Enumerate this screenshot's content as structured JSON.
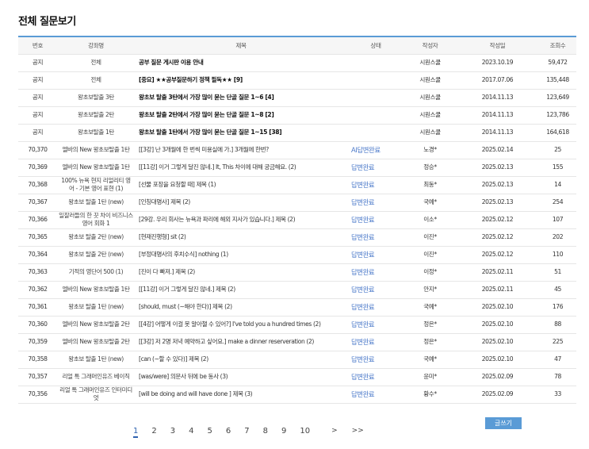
{
  "page_title": "전체 질문보기",
  "columns": [
    "번호",
    "강좌명",
    "제목",
    "상태",
    "작성자",
    "작성일",
    "조회수"
  ],
  "notices": [
    {
      "no": "공지",
      "course": "전체",
      "title": "공부 질문 게시판 이용 안내",
      "author": "시원스쿨",
      "date": "2023.10.19",
      "views": "59,472"
    },
    {
      "no": "공지",
      "course": "전체",
      "title": "[중요] ★★공부질문하기 정책 필독★★ [9]",
      "author": "시원스쿨",
      "date": "2017.07.06",
      "views": "135,448"
    },
    {
      "no": "공지",
      "course": "왕초보탈출 3탄",
      "title": "왕초보 탈출 3탄에서 가장 많이 묻는 단골 질문 1~6 [4]",
      "author": "시원스쿨",
      "date": "2014.11.13",
      "views": "123,649"
    },
    {
      "no": "공지",
      "course": "왕초보탈출 2탄",
      "title": "왕초보 탈출 2탄에서 가장 많이 묻는 단골 질문 1~8 [2]",
      "author": "시원스쿨",
      "date": "2014.11.13",
      "views": "123,786"
    },
    {
      "no": "공지",
      "course": "왕초보탈출 1탄",
      "title": "왕초보 탈출 1탄에서 가장 많이 묻는 단골 질문 1~15 [38]",
      "author": "시원스쿨",
      "date": "2014.11.13",
      "views": "164,618"
    }
  ],
  "rows": [
    {
      "no": "70,370",
      "course": "엘바의 New 왕초보탈출 1탄",
      "title": "[[3강] 난 3개월에 한 번씩 미용실에 가.] 3개월에 한번?",
      "status": "AI답변완료",
      "author": "노경*",
      "date": "2025.02.14",
      "views": "25"
    },
    {
      "no": "70,369",
      "course": "엘바의 New 왕초보탈출 1탄",
      "title": "[[11강] 이거 그렇게 달진 않네.] It, This 차이에 대해 궁금해요. (2)",
      "status": "답변완료",
      "author": "정승*",
      "date": "2025.02.13",
      "views": "155"
    },
    {
      "no": "70,368",
      "course": "100% 뉴욕 현지 리얼리티 영어 - 기본 영어 표현 (1)",
      "title": "[선물 포장을 요청할 때] 제목 (1)",
      "status": "답변완료",
      "author": "최동*",
      "date": "2025.02.13",
      "views": "14"
    },
    {
      "no": "70,367",
      "course": "왕초보 탈출 1탄 (new)",
      "title": "[인칭대명사] 제목 (2)",
      "status": "답변완료",
      "author": "국예*",
      "date": "2025.02.13",
      "views": "254"
    },
    {
      "no": "70,366",
      "course": "일잘러들의 한 끗 차이 비즈니스 영어 회화 1",
      "title": "[29강. 우리 회사는 뉴욕과 파리에 해외 지사가 있습니다.] 제목 (2)",
      "status": "답변완료",
      "author": "이소*",
      "date": "2025.02.12",
      "views": "107"
    },
    {
      "no": "70,365",
      "course": "왕초보 탈출 2탄 (new)",
      "title": "[현재진행형] sit (2)",
      "status": "답변완료",
      "author": "이진*",
      "date": "2025.02.12",
      "views": "202"
    },
    {
      "no": "70,364",
      "course": "왕초보 탈출 2탄 (new)",
      "title": "[부정대명사의 후치수식] nothing (1)",
      "status": "답변완료",
      "author": "이진*",
      "date": "2025.02.12",
      "views": "110"
    },
    {
      "no": "70,363",
      "course": "기적의 영단어 500 (1)",
      "title": "[진이 다 빠져.] 제목 (2)",
      "status": "답변완료",
      "author": "이정*",
      "date": "2025.02.11",
      "views": "51"
    },
    {
      "no": "70,362",
      "course": "엘바의 New 왕초보탈출 1탄",
      "title": "[[11강] 이거 그렇게 달진 않네.] 제목 (2)",
      "status": "답변완료",
      "author": "안지*",
      "date": "2025.02.11",
      "views": "45"
    },
    {
      "no": "70,361",
      "course": "왕초보 탈출 1탄 (new)",
      "title": "[should, must (~해야 한다)] 제목 (2)",
      "status": "답변완료",
      "author": "국예*",
      "date": "2025.02.10",
      "views": "176"
    },
    {
      "no": "70,360",
      "course": "엘바의 New 왕초보탈출 2탄",
      "title": "[[4강] 어떻게 이걸 못 알아챌 수 있어?] I've told you a hundred times (2)",
      "status": "답변완료",
      "author": "정은*",
      "date": "2025.02.10",
      "views": "88"
    },
    {
      "no": "70,359",
      "course": "엘바의 New 왕초보탈출 2탄",
      "title": "[[3강] 저 2명 저녁 예약하고 싶어요.] make a dinner reserveration (2)",
      "status": "답변완료",
      "author": "정은*",
      "date": "2025.02.10",
      "views": "225"
    },
    {
      "no": "70,358",
      "course": "왕초보 탈출 1탄 (new)",
      "title": "[can (~할 수 있다)] 제목 (2)",
      "status": "답변완료",
      "author": "국예*",
      "date": "2025.02.10",
      "views": "47"
    },
    {
      "no": "70,357",
      "course": "리얼 톡 그래머인유즈 베이직",
      "title": "[was/were] 의문사 뒤에 be 동사 (3)",
      "status": "답변완료",
      "author": "윤미*",
      "date": "2025.02.09",
      "views": "78"
    },
    {
      "no": "70,356",
      "course": "리얼 톡 그래머인유즈 인터미디엇",
      "title": "[will be doing and will have done ] 제목 (3)",
      "status": "답변완료",
      "author": "황수*",
      "date": "2025.02.09",
      "views": "33"
    }
  ],
  "pagination": {
    "pages": [
      "1",
      "2",
      "3",
      "4",
      "5",
      "6",
      "7",
      "8",
      "9",
      "10"
    ],
    "current": "1",
    "next": ">",
    "last": ">>"
  },
  "write_button": "글쓰기",
  "colors": {
    "accent": "#5a9bd6",
    "status": "#4a78c9"
  }
}
